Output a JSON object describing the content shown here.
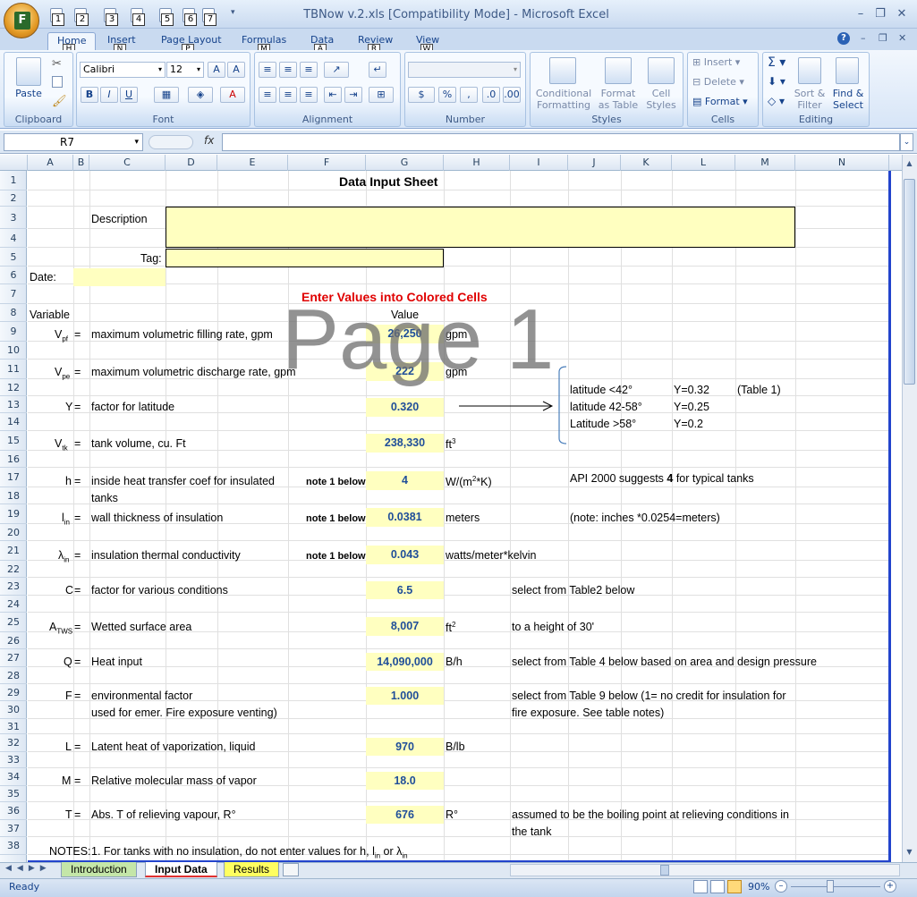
{
  "window": {
    "title": "TBNow v.2.xls  [Compatibility Mode] - Microsoft Excel"
  },
  "qat": {
    "keytips": [
      "1",
      "2",
      "3",
      "4",
      "5",
      "6",
      "7"
    ]
  },
  "tabs": [
    {
      "label": "Home",
      "key": "H"
    },
    {
      "label": "Insert",
      "key": "N"
    },
    {
      "label": "Page Layout",
      "key": "P"
    },
    {
      "label": "Formulas",
      "key": "M"
    },
    {
      "label": "Data",
      "key": "A"
    },
    {
      "label": "Review",
      "key": "R"
    },
    {
      "label": "View",
      "key": "W"
    }
  ],
  "ribbon": {
    "clipboard": {
      "label": "Clipboard",
      "paste": "Paste"
    },
    "font": {
      "label": "Font",
      "name": "Calibri",
      "size": "12"
    },
    "alignment": {
      "label": "Alignment"
    },
    "number": {
      "label": "Number"
    },
    "styles": {
      "label": "Styles",
      "conditional": "Conditional",
      "conditional2": "Formatting",
      "format_table": "Format",
      "format_table2": "as Table",
      "cell_styles": "Cell",
      "cell_styles2": "Styles"
    },
    "cells": {
      "label": "Cells",
      "insert": "Insert",
      "delete": "Delete",
      "format": "Format"
    },
    "editing": {
      "label": "Editing",
      "sort": "Sort &",
      "sort2": "Filter",
      "find": "Find &",
      "find2": "Select"
    }
  },
  "formula_bar": {
    "name_box": "R7",
    "fx": "fx",
    "formula": ""
  },
  "columns": [
    "A",
    "B",
    "C",
    "D",
    "E",
    "F",
    "G",
    "H",
    "I",
    "J",
    "K",
    "L",
    "M",
    "N"
  ],
  "rows": [
    "1",
    "2",
    "3",
    "4",
    "5",
    "6",
    "7",
    "8",
    "9",
    "10",
    "11",
    "12",
    "13",
    "14",
    "15",
    "16",
    "17",
    "18",
    "19",
    "20",
    "21",
    "22",
    "23",
    "24",
    "25",
    "26",
    "27",
    "28",
    "29",
    "30",
    "31",
    "32",
    "33",
    "34",
    "35",
    "36",
    "37",
    "38"
  ],
  "sheet": {
    "title": "Data Input Sheet",
    "description_label": "Description",
    "tag_label": "Tag:",
    "date_label": "Date:",
    "instruction": "Enter Values into Colored Cells",
    "variable_header": "Variable",
    "value_header": "Value",
    "note1": "note 1 below",
    "eq": "=",
    "items": {
      "vpf": {
        "sym": "V",
        "sub": "pf",
        "desc": "maximum volumetric filling rate, gpm",
        "value": "26,250",
        "unit": "gpm"
      },
      "vpe": {
        "sym": "V",
        "sub": "pe",
        "desc": "maximum volumetric discharge rate, gpm",
        "value": "222",
        "unit": "gpm"
      },
      "y": {
        "sym": "Y",
        "desc": "factor for latitude",
        "value": "0.320"
      },
      "vtk": {
        "sym": "V",
        "sub": "tk",
        "desc": "tank volume, cu. Ft",
        "value": "238,330",
        "unit": "ft",
        "unit_sup": "3"
      },
      "h": {
        "sym": "h",
        "desc": "inside heat transfer coef for insulated",
        "desc2": "tanks",
        "value": "4",
        "unit": "W/(m",
        "unit_sup": "2",
        "unit_tail": "*K)",
        "note": "API 2000 suggests ",
        "note_bold": "4",
        "note_tail": " for typical tanks"
      },
      "lin": {
        "sym": "l",
        "sub": "in",
        "desc": "wall thickness of insulation",
        "value": "0.0381",
        "unit": "meters",
        "note": "(note: inches *0.0254=meters)"
      },
      "lam": {
        "sym": "λ",
        "sub": "in",
        "desc": "insulation thermal conductivity",
        "value": "0.043",
        "unit": "watts/meter*kelvin"
      },
      "c": {
        "sym": "C",
        "desc": "factor for various conditions",
        "value": "6.5",
        "note": "select from Table2 below"
      },
      "atws": {
        "sym": "A",
        "sub": "TWS",
        "desc": "Wetted surface area",
        "value": "8,007",
        "unit": "ft",
        "unit_sup": "2",
        "note": "to a height of 30'"
      },
      "q": {
        "sym": "Q",
        "desc": "Heat input",
        "value": "14,090,000",
        "unit": "B/h",
        "note": "select from Table 4 below  based on area and design pressure"
      },
      "f": {
        "sym": "F",
        "desc": "environmental factor",
        "desc2": "used for emer. Fire exposure venting)",
        "value": "1.000",
        "note": "select from Table 9 below (1= no credit for insulation for",
        "note2": "fire exposure. See table notes)"
      },
      "l": {
        "sym": "L",
        "desc": "Latent heat of vaporization, liquid",
        "value": "970",
        "unit": "B/lb"
      },
      "m": {
        "sym": "M",
        "desc": "Relative molecular mass of vapor",
        "value": "18.0"
      },
      "t": {
        "sym": "T",
        "desc": "Abs. T of relieving vapour, R°",
        "value": "676",
        "unit": "R°",
        "note": "assumed to be the boiling point at relieving conditions in",
        "note2": "the tank"
      }
    },
    "latitude": {
      "r1": "latitude <42°",
      "y1": "Y=0.32",
      "table": "(Table 1)",
      "r2": "latitude 42-58°",
      "y2": "Y=0.25",
      "r3": "Latitude >58°",
      "y3": "Y=0.2"
    },
    "notes_label": "NOTES:",
    "notes_text": "1.  For tanks with no insulation, do not enter values for h, l",
    "notes_sub1": "in",
    "notes_mid": " or λ",
    "notes_sub2": "in",
    "watermark": "Page 1"
  },
  "sheet_tabs": [
    "Introduction",
    "Input Data",
    "Results"
  ],
  "status": {
    "ready": "Ready",
    "zoom": "90%"
  }
}
